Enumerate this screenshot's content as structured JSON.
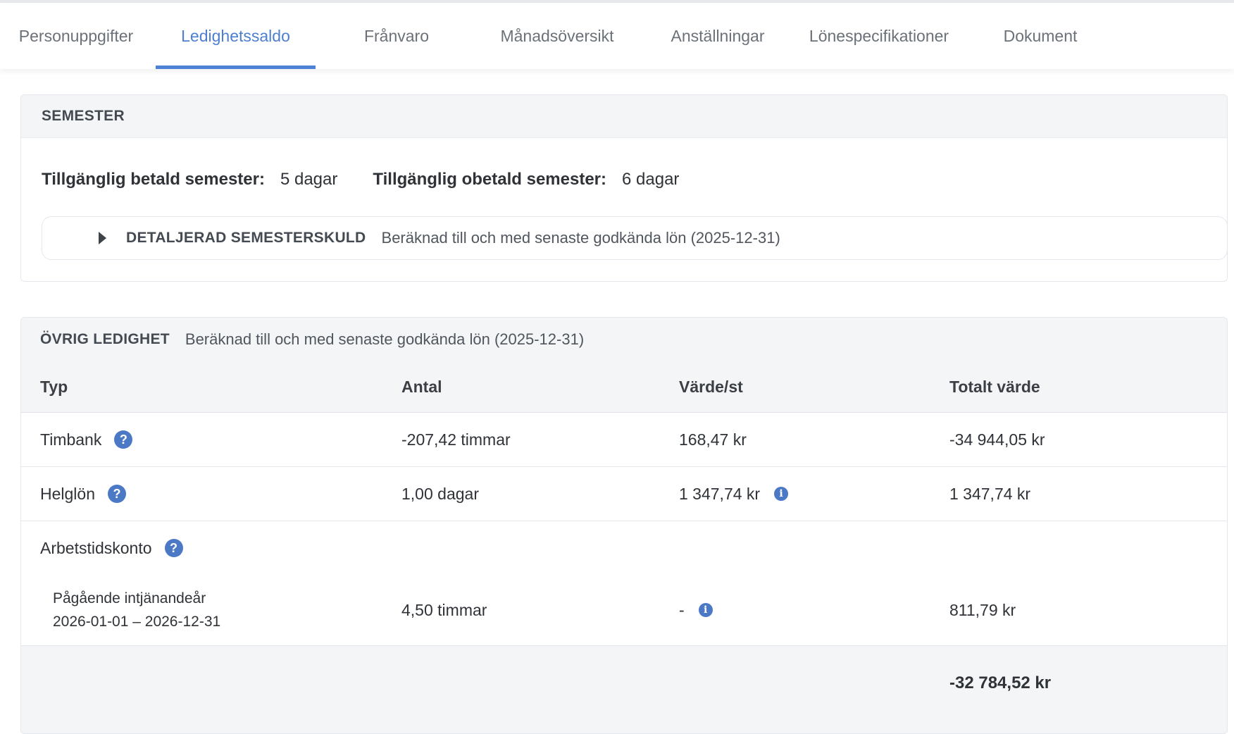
{
  "tabs": [
    {
      "label": "Personuppgifter",
      "active": false
    },
    {
      "label": "Ledighetssaldo",
      "active": true
    },
    {
      "label": "Frånvaro",
      "active": false
    },
    {
      "label": "Månadsöversikt",
      "active": false
    },
    {
      "label": "Anställningar",
      "active": false
    },
    {
      "label": "Lönespecifikationer",
      "active": false
    },
    {
      "label": "Dokument",
      "active": false
    }
  ],
  "semester": {
    "title": "SEMESTER",
    "paid_label": "Tillgänglig betald semester:",
    "paid_value": "5 dagar",
    "unpaid_label": "Tillgänglig obetald semester:",
    "unpaid_value": "6 dagar",
    "detail_title": "DETALJERAD SEMESTERSKULD",
    "detail_subtitle": "Beräknad till och med senaste godkända lön (2025-12-31)"
  },
  "ovrig": {
    "title": "ÖVRIG LEDIGHET",
    "subtitle": "Beräknad till och med senaste godkända lön (2025-12-31)",
    "columns": [
      "Typ",
      "Antal",
      "Värde/st",
      "Totalt värde"
    ],
    "rows": [
      {
        "typ": "Timbank",
        "antal": "-207,42 timmar",
        "varde": "168,47 kr",
        "totalt": "-34 944,05 kr"
      },
      {
        "typ": "Helglön",
        "antal": "1,00 dagar",
        "varde": "1 347,74 kr",
        "totalt": "1 347,74 kr"
      },
      {
        "typ": "Arbetstidskonto"
      },
      {
        "typ_line1": "Pågående intjänandeår",
        "typ_line2": "2026-01-01 – 2026-12-31",
        "antal": "4,50 timmar",
        "varde": "-",
        "totalt": "811,79 kr"
      }
    ],
    "total": "-32 784,52 kr"
  },
  "colors": {
    "accent": "#4d82d6",
    "icon": "#4c79c6",
    "header_bg": "#f4f5f7"
  },
  "icons": {
    "help": "question-circle-icon",
    "info": "info-circle-icon",
    "expand": "caret-right-icon"
  }
}
